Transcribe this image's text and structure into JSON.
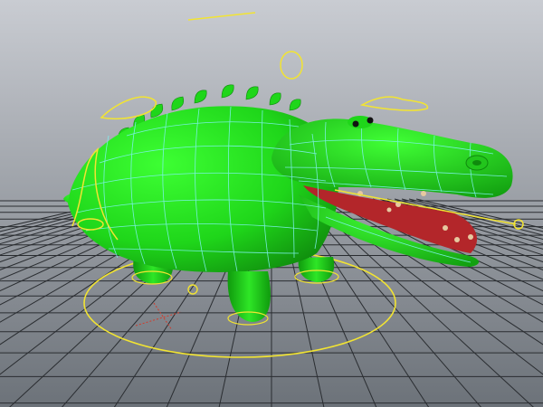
{
  "scene": {
    "background_top": "#c9ccd2",
    "background_bottom": "#6c7279",
    "grid_color": "#2a2d31",
    "grid_axis_color": "#111214",
    "model_color": "#1fd61a",
    "model_shade": "#0f8a0d",
    "wireframe_color": "#7ff2f0",
    "mouth_color": "#b3262a",
    "rig_control_color": "#f2e432",
    "pivot_marker_color": "#d23a2a"
  }
}
